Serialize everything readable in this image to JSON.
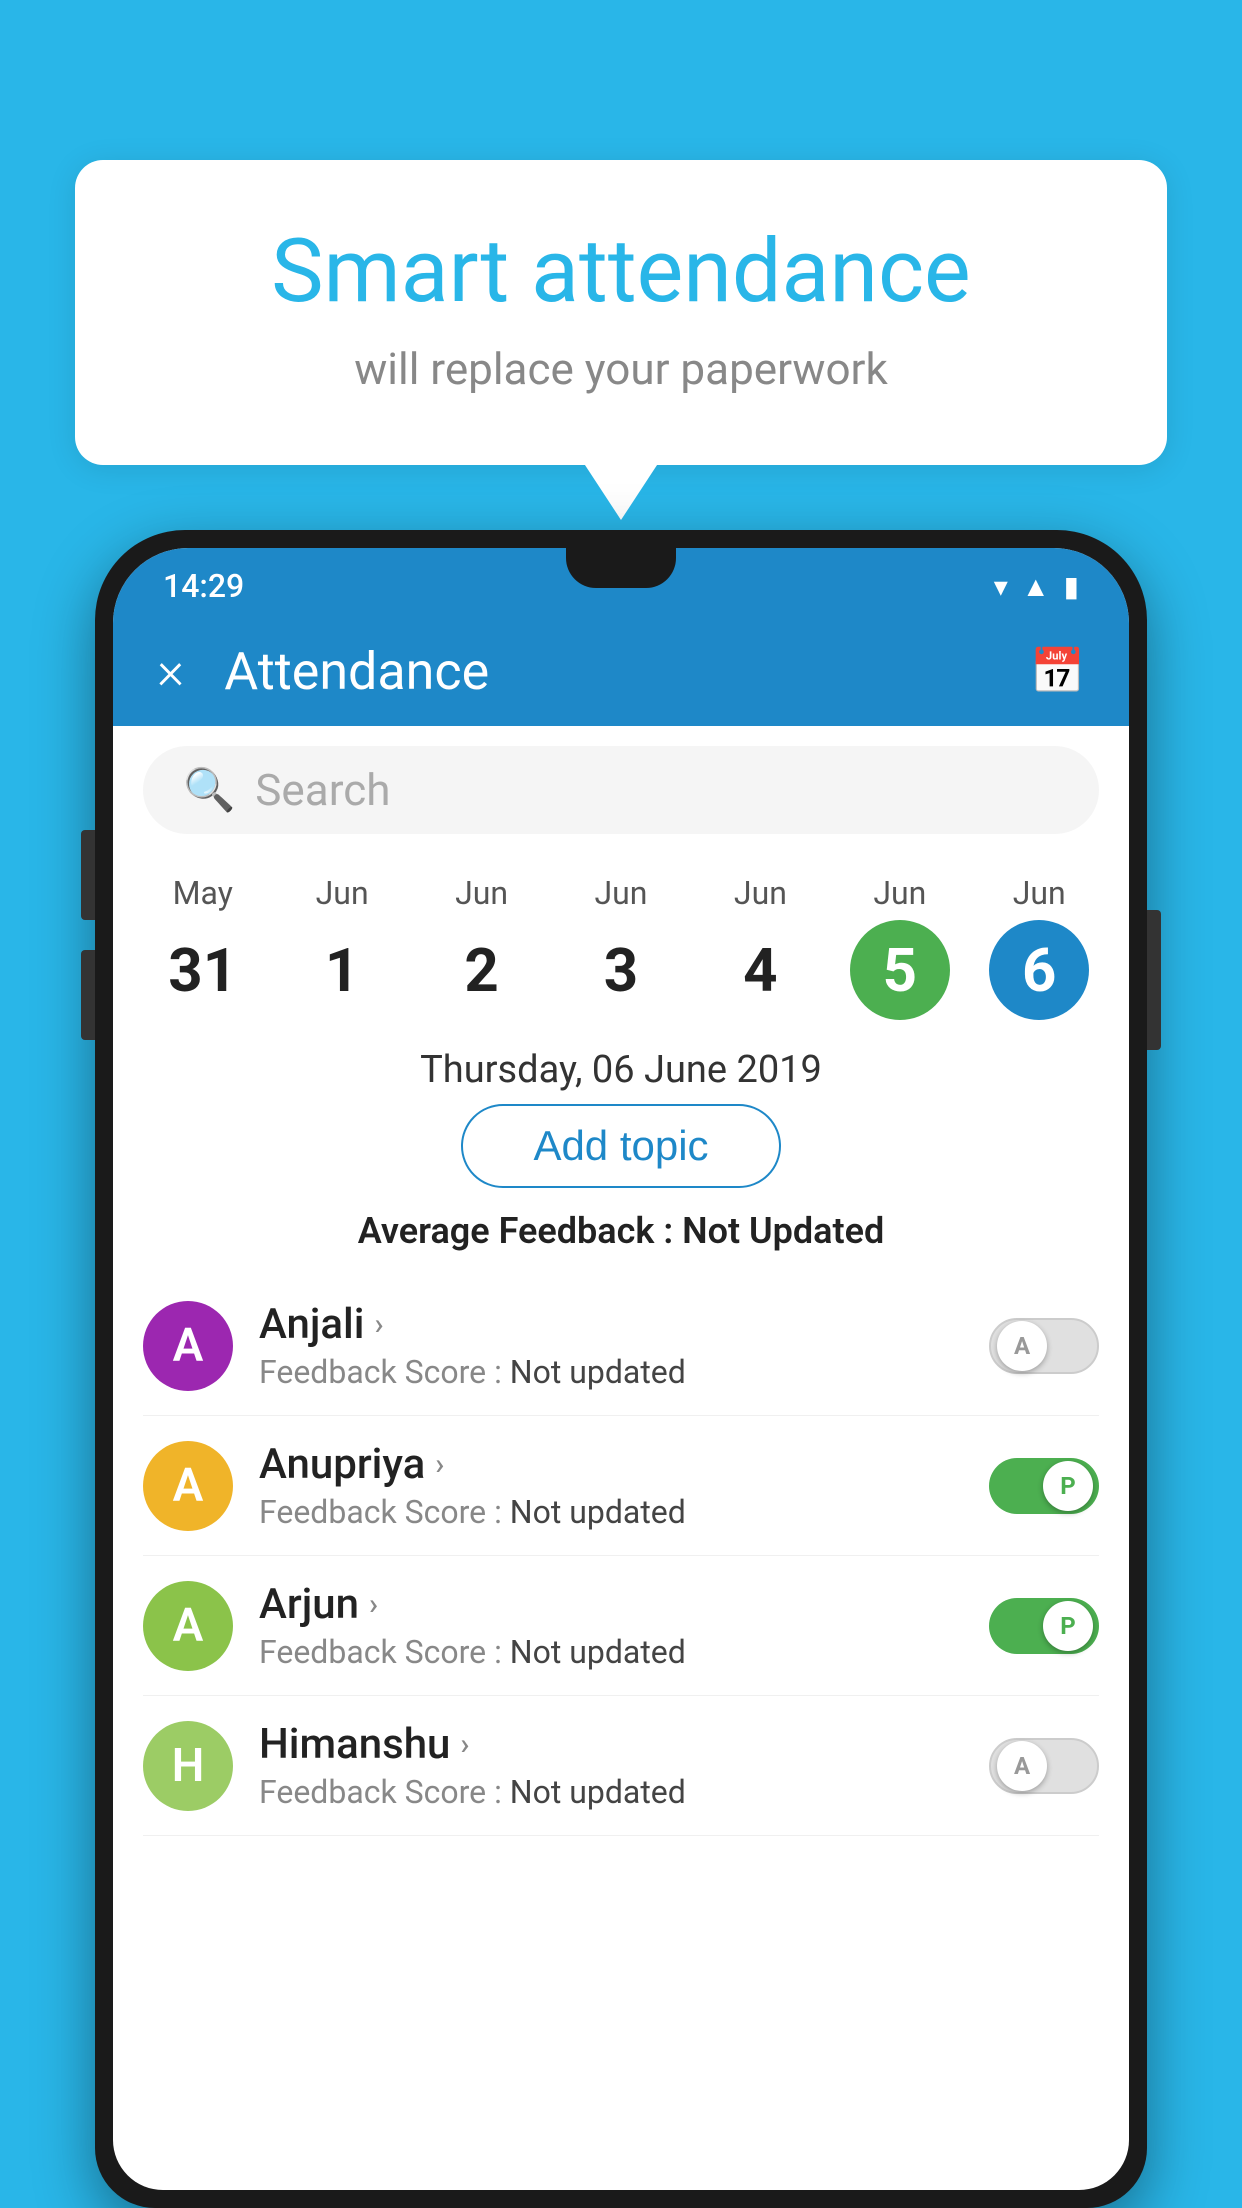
{
  "page": {
    "background_color": "#29b6e8"
  },
  "bubble": {
    "title": "Smart attendance",
    "subtitle": "will replace your paperwork"
  },
  "status_bar": {
    "time": "14:29"
  },
  "app_bar": {
    "title": "Attendance",
    "close_label": "×"
  },
  "search": {
    "placeholder": "Search"
  },
  "calendar": {
    "days": [
      {
        "month": "May",
        "date": "31",
        "state": "normal"
      },
      {
        "month": "Jun",
        "date": "1",
        "state": "normal"
      },
      {
        "month": "Jun",
        "date": "2",
        "state": "normal"
      },
      {
        "month": "Jun",
        "date": "3",
        "state": "normal"
      },
      {
        "month": "Jun",
        "date": "4",
        "state": "normal"
      },
      {
        "month": "Jun",
        "date": "5",
        "state": "today"
      },
      {
        "month": "Jun",
        "date": "6",
        "state": "selected"
      }
    ],
    "selected_date_display": "Thursday, 06 June 2019"
  },
  "add_topic_button": "Add topic",
  "average_feedback": {
    "label": "Average Feedback : ",
    "value": "Not Updated"
  },
  "students": [
    {
      "name": "Anjali",
      "avatar_letter": "A",
      "avatar_color": "#9c27b0",
      "feedback_label": "Feedback Score : ",
      "feedback_value": "Not updated",
      "toggle_state": "off",
      "toggle_letter": "A"
    },
    {
      "name": "Anupriya",
      "avatar_letter": "A",
      "avatar_color": "#f0b429",
      "feedback_label": "Feedback Score : ",
      "feedback_value": "Not updated",
      "toggle_state": "on",
      "toggle_letter": "P"
    },
    {
      "name": "Arjun",
      "avatar_letter": "A",
      "avatar_color": "#8bc34a",
      "feedback_label": "Feedback Score : ",
      "feedback_value": "Not updated",
      "toggle_state": "on",
      "toggle_letter": "P"
    },
    {
      "name": "Himanshu",
      "avatar_letter": "H",
      "avatar_color": "#9ccc65",
      "feedback_label": "Feedback Score : ",
      "feedback_value": "Not updated",
      "toggle_state": "off",
      "toggle_letter": "A"
    }
  ]
}
